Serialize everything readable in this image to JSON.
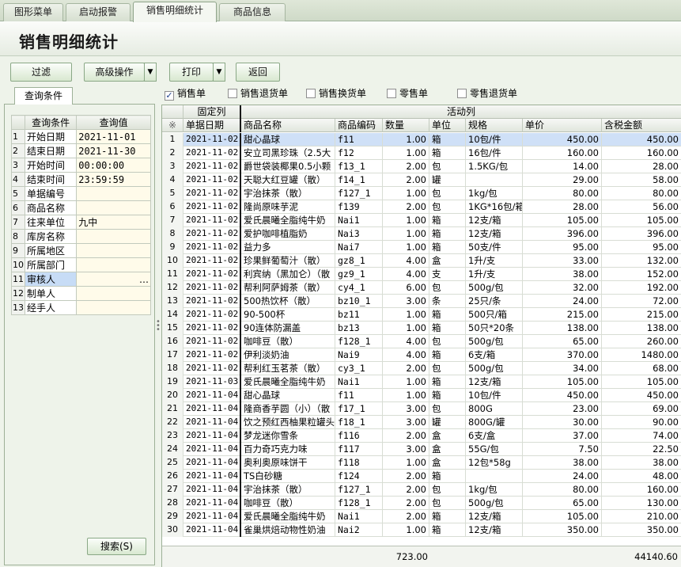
{
  "tabs": [
    {
      "label": "图形菜单"
    },
    {
      "label": "启动报警"
    },
    {
      "label": "销售明细统计"
    },
    {
      "label": "商品信息"
    }
  ],
  "page_title": "销售明细统计",
  "toolbar": {
    "filter": "过滤",
    "advanced": "高级操作",
    "print": "打印",
    "back": "返回",
    "dropdown_glyph": "▼"
  },
  "query_tab": "查询条件",
  "query_grid": {
    "header": {
      "cond": "查询条件",
      "val": "查询值"
    },
    "rows": [
      {
        "n": "1",
        "cond": "开始日期",
        "val": "2021-11-01"
      },
      {
        "n": "2",
        "cond": "结束日期",
        "val": "2021-11-30"
      },
      {
        "n": "3",
        "cond": "开始时间",
        "val": "00:00:00"
      },
      {
        "n": "4",
        "cond": "结束时间",
        "val": "23:59:59"
      },
      {
        "n": "5",
        "cond": "单据编号",
        "val": ""
      },
      {
        "n": "6",
        "cond": "商品名称",
        "val": ""
      },
      {
        "n": "7",
        "cond": "往来单位",
        "val": "九中"
      },
      {
        "n": "8",
        "cond": "库房名称",
        "val": ""
      },
      {
        "n": "9",
        "cond": "所属地区",
        "val": ""
      },
      {
        "n": "10",
        "cond": "所属部门",
        "val": ""
      },
      {
        "n": "11",
        "cond": "审核人",
        "val": "…"
      },
      {
        "n": "12",
        "cond": "制单人",
        "val": ""
      },
      {
        "n": "13",
        "cond": "经手人",
        "val": ""
      }
    ]
  },
  "search_button": "搜索(S)",
  "doc_types": [
    {
      "label": "销售单",
      "checked": true
    },
    {
      "label": "销售退货单",
      "checked": false
    },
    {
      "label": "销售换货单",
      "checked": false
    },
    {
      "label": "零售单",
      "checked": false
    },
    {
      "label": "零售退货单",
      "checked": false
    }
  ],
  "check_glyph": "✓",
  "grid": {
    "group_fixed": "固定列",
    "group_active": "活动列",
    "row_marker": "※",
    "columns": [
      "单据日期",
      "商品名称",
      "商品编码",
      "数量",
      "单位",
      "规格",
      "单价",
      "含税金额"
    ],
    "rows": [
      [
        "2021-11-02",
        "甜心晶球",
        "f11",
        "1.00",
        "箱",
        "10包/件",
        "450.00",
        "450.00"
      ],
      [
        "2021-11-02",
        "安立司黑珍珠（2.5大",
        "f12",
        "1.00",
        "箱",
        "16包/件",
        "160.00",
        "160.00"
      ],
      [
        "2021-11-02",
        "爵世袋装椰果0.5小颗",
        "f13_1",
        "2.00",
        "包",
        "1.5KG/包",
        "14.00",
        "28.00"
      ],
      [
        "2021-11-02",
        "天聪大红豆罐（散）",
        "f14_1",
        "2.00",
        "罐",
        "",
        "29.00",
        "58.00"
      ],
      [
        "2021-11-02",
        "宇治抹茶（散）",
        "f127_1",
        "1.00",
        "包",
        "1kg/包",
        "80.00",
        "80.00"
      ],
      [
        "2021-11-02",
        "隆尚原味芋泥",
        "f139",
        "2.00",
        "包",
        "1KG*16包/箱",
        "28.00",
        "56.00"
      ],
      [
        "2021-11-02",
        "爱氏晨曦全脂纯牛奶",
        "Nai1",
        "1.00",
        "箱",
        "12支/箱",
        "105.00",
        "105.00"
      ],
      [
        "2021-11-02",
        "爱护咖啡植脂奶",
        "Nai3",
        "1.00",
        "箱",
        "12支/箱",
        "396.00",
        "396.00"
      ],
      [
        "2021-11-02",
        "益力多",
        "Nai7",
        "1.00",
        "箱",
        "50支/件",
        "95.00",
        "95.00"
      ],
      [
        "2021-11-02",
        "珍果鲜葡萄汁（散）",
        "gz8_1",
        "4.00",
        "盒",
        "1升/支",
        "33.00",
        "132.00"
      ],
      [
        "2021-11-02",
        "利宾纳（黑加仑）（散",
        "gz9_1",
        "4.00",
        "支",
        "1升/支",
        "38.00",
        "152.00"
      ],
      [
        "2021-11-02",
        "帮利阿萨姆茶（散）",
        "cy4_1",
        "6.00",
        "包",
        "500g/包",
        "32.00",
        "192.00"
      ],
      [
        "2021-11-02",
        "500热饮杯（散）",
        "bz10_1",
        "3.00",
        "条",
        "25只/条",
        "24.00",
        "72.00"
      ],
      [
        "2021-11-02",
        "90-500杯",
        "bz11",
        "1.00",
        "箱",
        "500只/箱",
        "215.00",
        "215.00"
      ],
      [
        "2021-11-02",
        "90连体防漏盖",
        "bz13",
        "1.00",
        "箱",
        "50只*20条",
        "138.00",
        "138.00"
      ],
      [
        "2021-11-02",
        "咖啡豆（散）",
        "f128_1",
        "4.00",
        "包",
        "500g/包",
        "65.00",
        "260.00"
      ],
      [
        "2021-11-02",
        "伊利淡奶油",
        "Nai9",
        "4.00",
        "箱",
        "6支/箱",
        "370.00",
        "1480.00"
      ],
      [
        "2021-11-02",
        "帮利红玉茗茶（散）",
        "cy3_1",
        "2.00",
        "包",
        "500g/包",
        "34.00",
        "68.00"
      ],
      [
        "2021-11-03",
        "爱氏晨曦全脂纯牛奶",
        "Nai1",
        "1.00",
        "箱",
        "12支/箱",
        "105.00",
        "105.00"
      ],
      [
        "2021-11-04",
        "甜心晶球",
        "f11",
        "1.00",
        "箱",
        "10包/件",
        "450.00",
        "450.00"
      ],
      [
        "2021-11-04",
        "隆商香芋圆（小）（散",
        "f17_1",
        "3.00",
        "包",
        "800G",
        "23.00",
        "69.00"
      ],
      [
        "2021-11-04",
        "饮之预红西柚果粒罐头",
        "f18_1",
        "3.00",
        "罐",
        "800G/罐",
        "30.00",
        "90.00"
      ],
      [
        "2021-11-04",
        "梦龙迷你雪条",
        "f116",
        "2.00",
        "盒",
        "6支/盒",
        "37.00",
        "74.00"
      ],
      [
        "2021-11-04",
        "百力奇巧克力味",
        "f117",
        "3.00",
        "盒",
        "55G/包",
        "7.50",
        "22.50"
      ],
      [
        "2021-11-04",
        "奥利奥原味饼干",
        "f118",
        "1.00",
        "盒",
        "12包*58g",
        "38.00",
        "38.00"
      ],
      [
        "2021-11-04",
        "TS白砂糖",
        "f124",
        "2.00",
        "箱",
        "",
        "24.00",
        "48.00"
      ],
      [
        "2021-11-04",
        "宇治抹茶（散）",
        "f127_1",
        "2.00",
        "包",
        "1kg/包",
        "80.00",
        "160.00"
      ],
      [
        "2021-11-04",
        "咖啡豆（散）",
        "f128_1",
        "2.00",
        "包",
        "500g/包",
        "65.00",
        "130.00"
      ],
      [
        "2021-11-04",
        "爱氏晨曦全脂纯牛奶",
        "Nai1",
        "2.00",
        "箱",
        "12支/箱",
        "105.00",
        "210.00"
      ],
      [
        "2021-11-04",
        "雀巢烘焙动物性奶油",
        "Nai2",
        "1.00",
        "箱",
        "12支/箱",
        "350.00",
        "350.00"
      ]
    ],
    "total_qty": "723.00",
    "total_amount": "44140.60"
  }
}
